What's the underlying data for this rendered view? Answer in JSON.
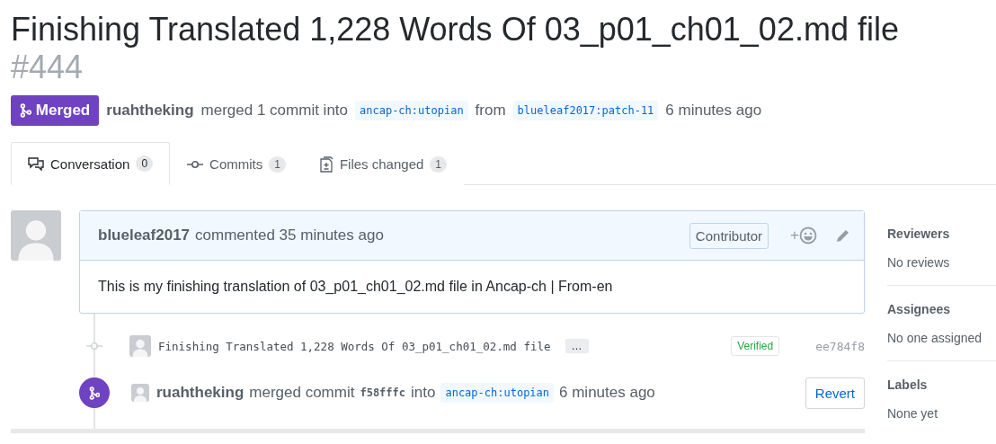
{
  "title": {
    "text": "Finishing Translated 1,228 Words Of 03_p01_ch01_02.md file",
    "number": "#444"
  },
  "status": {
    "label": "Merged",
    "kind": "merged"
  },
  "summary": {
    "author": "ruahtheking",
    "action": "merged 1 commit into",
    "base": "ancap-ch:utopian",
    "from": "from",
    "head": "blueleaf2017:patch-11",
    "time": "6 minutes ago"
  },
  "tabs": [
    {
      "label": "Conversation",
      "count": "0",
      "kind": "conversation",
      "selected": true
    },
    {
      "label": "Commits",
      "count": "1",
      "kind": "commits",
      "selected": false
    },
    {
      "label": "Files changed",
      "count": "1",
      "kind": "files",
      "selected": false
    }
  ],
  "comment": {
    "author": "blueleaf2017",
    "action": "commented 35 minutes ago",
    "role": "Contributor",
    "reaction_plus": "+",
    "body": "This is my finishing translation of 03_p01_ch01_02.md file in Ancap-ch | From-en"
  },
  "commit": {
    "message": "Finishing Translated 1,228 Words Of 03_p01_ch01_02.md file",
    "more": "…",
    "verified": "Verified",
    "sha": "ee784f8"
  },
  "merge_event": {
    "author": "ruahtheking",
    "action": "merged commit",
    "sha": "f58fffc",
    "into": "into",
    "base": "ancap-ch:utopian",
    "time": "6 minutes ago",
    "button": "Revert"
  },
  "sidebar": [
    {
      "heading": "Reviewers",
      "value": "No reviews"
    },
    {
      "heading": "Assignees",
      "value": "No one assigned"
    },
    {
      "heading": "Labels",
      "value": "None yet"
    }
  ]
}
